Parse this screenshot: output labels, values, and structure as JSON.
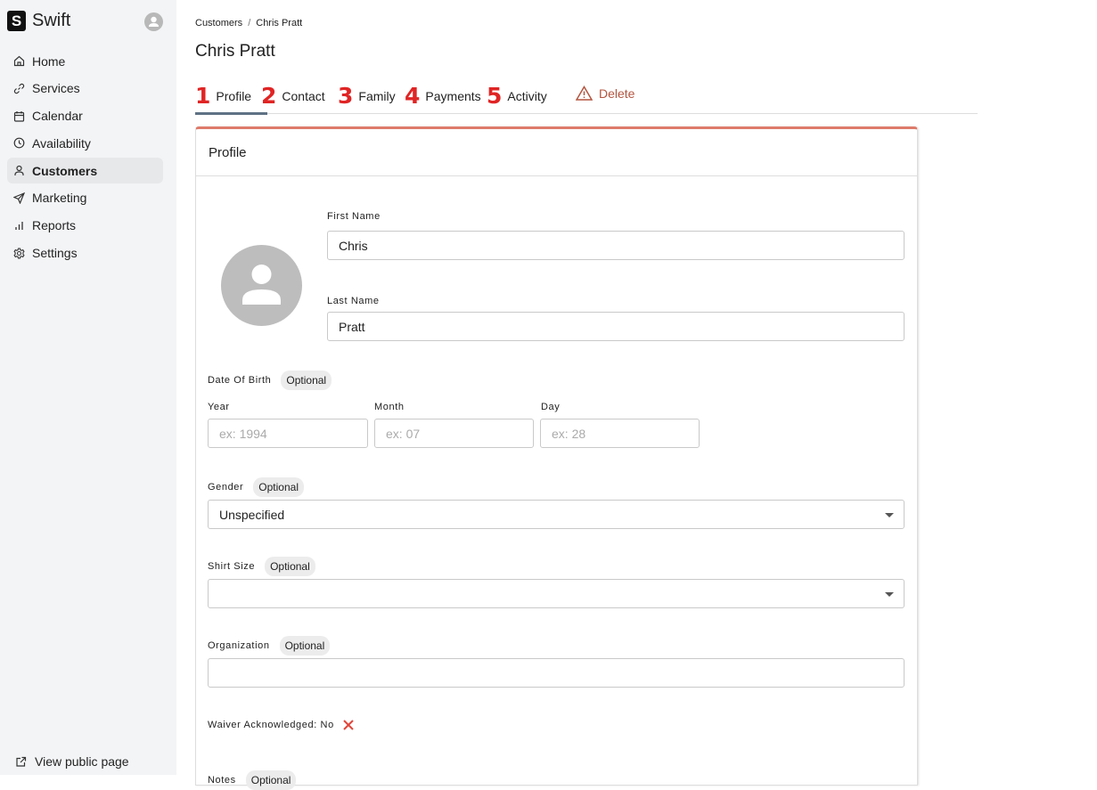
{
  "app": {
    "name": "Swift",
    "logo_letter": "S"
  },
  "sidebar": {
    "items": [
      {
        "label": "Home",
        "icon": "home-icon",
        "active": false
      },
      {
        "label": "Services",
        "icon": "link-icon",
        "active": false
      },
      {
        "label": "Calendar",
        "icon": "calendar-icon",
        "active": false
      },
      {
        "label": "Availability",
        "icon": "clock-icon",
        "active": false
      },
      {
        "label": "Customers",
        "icon": "user-icon",
        "active": true
      },
      {
        "label": "Marketing",
        "icon": "send-icon",
        "active": false
      },
      {
        "label": "Reports",
        "icon": "bar-chart-icon",
        "active": false
      },
      {
        "label": "Settings",
        "icon": "gear-icon",
        "active": false
      }
    ],
    "footer_link": "View public page"
  },
  "breadcrumb": {
    "parent": "Customers",
    "separator": "/",
    "current": "Chris Pratt"
  },
  "page_title": "Chris Pratt",
  "tabs": [
    {
      "num": "1",
      "label": "Profile",
      "active": true
    },
    {
      "num": "2",
      "label": "Contact",
      "active": false
    },
    {
      "num": "3",
      "label": "Family",
      "active": false
    },
    {
      "num": "4",
      "label": "Payments",
      "active": false
    },
    {
      "num": "5",
      "label": "Activity",
      "active": false
    }
  ],
  "delete_label": "Delete",
  "colors": {
    "accent": "#de7b6a",
    "danger": "#b3553f",
    "tab_underline": "#5f7285",
    "annotation": "#e02424"
  },
  "profile": {
    "header": "Profile",
    "first_name": {
      "label": "First Name",
      "value": "Chris"
    },
    "last_name": {
      "label": "Last Name",
      "value": "Pratt"
    },
    "dob": {
      "label": "Date Of Birth",
      "optional": "Optional",
      "year": {
        "label": "Year",
        "placeholder": "ex: 1994"
      },
      "month": {
        "label": "Month",
        "placeholder": "ex: 07"
      },
      "day": {
        "label": "Day",
        "placeholder": "ex: 28"
      }
    },
    "gender": {
      "label": "Gender",
      "optional": "Optional",
      "value": "Unspecified"
    },
    "shirt_size": {
      "label": "Shirt Size",
      "optional": "Optional",
      "value": ""
    },
    "organization": {
      "label": "Organization",
      "optional": "Optional",
      "value": ""
    },
    "waiver": {
      "label": "Waiver Acknowledged: No"
    },
    "notes": {
      "label": "Notes",
      "optional": "Optional"
    }
  }
}
